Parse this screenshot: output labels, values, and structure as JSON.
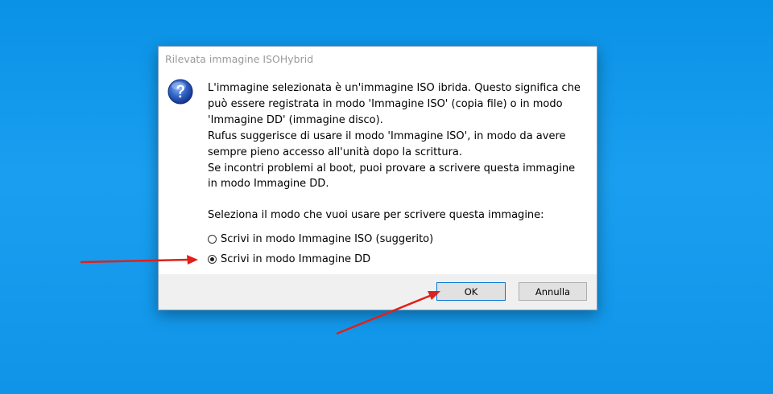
{
  "dialog": {
    "title": "Rilevata immagine ISOHybrid",
    "message_1": "L'immagine selezionata è un'immagine ISO ibrida. Questo significa che\npuò essere registrata in modo 'Immagine ISO' (copia file) o in modo\n'Immagine DD' (immagine disco).\nRufus suggerisce di usare il modo 'Immagine ISO', in modo da avere\nsempre pieno accesso all'unità dopo la scrittura.\nSe incontri problemi al boot, puoi provare a scrivere questa immagine\nin modo Immagine DD.",
    "message_2": "Seleziona il modo che vuoi usare per scrivere questa immagine:",
    "options": [
      {
        "label": "Scrivi in modo Immagine ISO (suggerito)",
        "selected": false
      },
      {
        "label": "Scrivi in modo Immagine DD",
        "selected": true
      }
    ],
    "ok_label": "OK",
    "cancel_label": "Annulla"
  },
  "colors": {
    "desktop": "#0a92e6",
    "annotation_arrow": "#e0201b",
    "ok_border": "#0078d7"
  },
  "icons": {
    "dialog_icon": "question-icon"
  }
}
